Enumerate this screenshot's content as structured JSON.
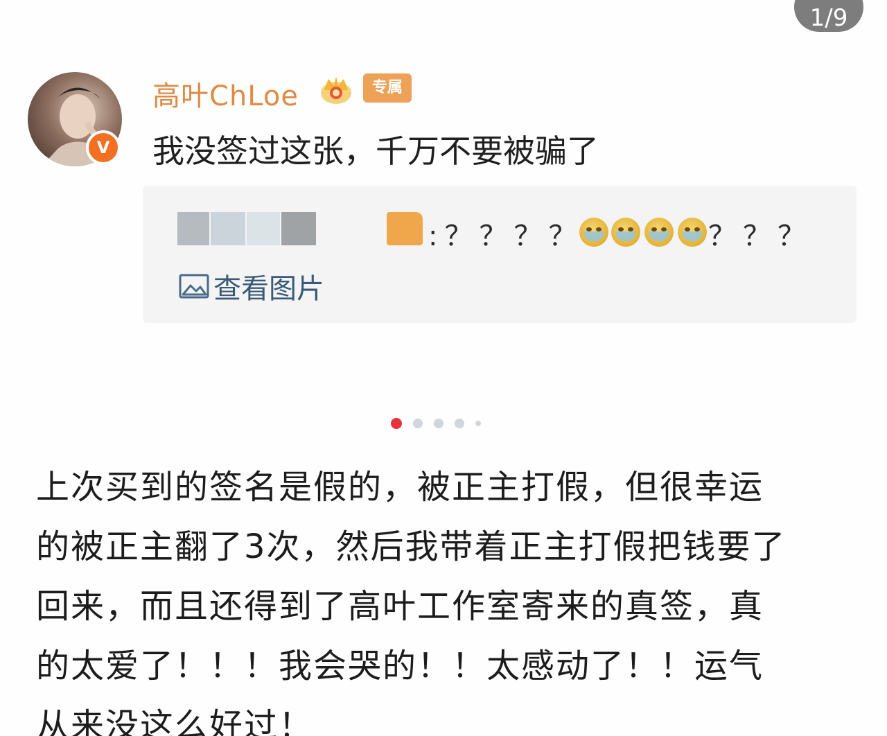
{
  "counter": "1/9",
  "profile": {
    "username": "高叶ChLoe",
    "badge_label": "专属",
    "verified_mark": "V",
    "post_text": "我没签过这张，千万不要被骗了"
  },
  "quote": {
    "text_before_emoji": ":？？？？",
    "text_after_emoji": "？？？",
    "emoji_icon": "crying-emoji-icon",
    "view_picture_label": "查看图片"
  },
  "carousel": {
    "dot_count": 5,
    "active_index": 0
  },
  "body": {
    "lines": [
      "上次买到的签名是假的，被正主打假，但很幸运",
      "的被正主翻了3次，然后我带着正主打假把钱要了",
      "回来，而且还得到了高叶工作室寄来的真签，真",
      "的太爱了！！！我会哭的！！太感动了！！运气",
      "从来没这么好过！"
    ]
  },
  "colors": {
    "username": "#e08a43",
    "badge": "#eea257",
    "verified": "#f36f21",
    "active_dot": "#e8323e",
    "link": "#3a5a7a"
  }
}
